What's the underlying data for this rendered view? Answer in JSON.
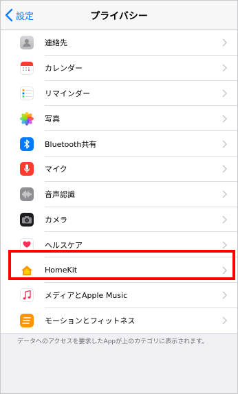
{
  "nav": {
    "back_label": "設定",
    "title": "プライバシー"
  },
  "rows": [
    {
      "label": "連絡先",
      "icon": "contacts-icon"
    },
    {
      "label": "カレンダー",
      "icon": "calendar-icon"
    },
    {
      "label": "リマインダー",
      "icon": "reminders-icon"
    },
    {
      "label": "写真",
      "icon": "photos-icon"
    },
    {
      "label": "Bluetooth共有",
      "icon": "bluetooth-icon"
    },
    {
      "label": "マイク",
      "icon": "microphone-icon"
    },
    {
      "label": "音声認識",
      "icon": "speech-recognition-icon"
    },
    {
      "label": "カメラ",
      "icon": "camera-icon"
    },
    {
      "label": "ヘルスケア",
      "icon": "health-icon"
    },
    {
      "label": "HomeKit",
      "icon": "homekit-icon"
    },
    {
      "label": "メディアとApple Music",
      "icon": "music-icon"
    },
    {
      "label": "モーションとフィットネス",
      "icon": "motion-fitness-icon"
    }
  ],
  "footer": "データへのアクセスを要求したAppが上のカテゴリに表示されます。",
  "colors": {
    "accent": "#0a7aff",
    "highlight": "#ff0000"
  }
}
